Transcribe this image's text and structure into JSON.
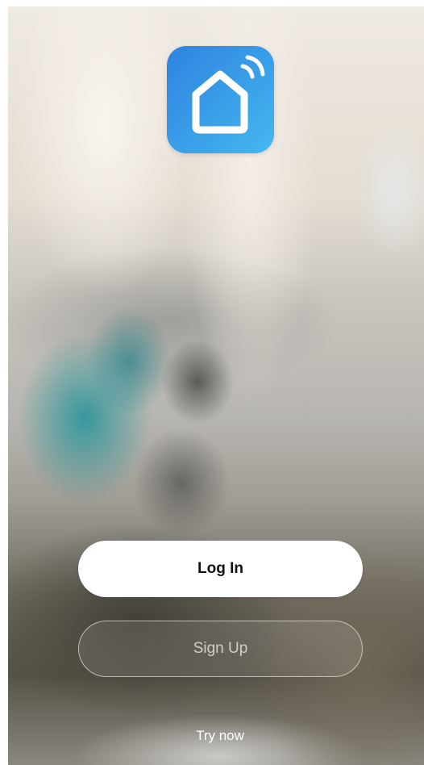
{
  "login_screen": {
    "logo_icon": "smart-home-wifi-icon",
    "login_label": "Log In",
    "signup_label": "Sign Up",
    "try_now_label": "Try now"
  },
  "colors": {
    "logo_blue": "#3a9fe8",
    "button_white": "#ffffff"
  }
}
